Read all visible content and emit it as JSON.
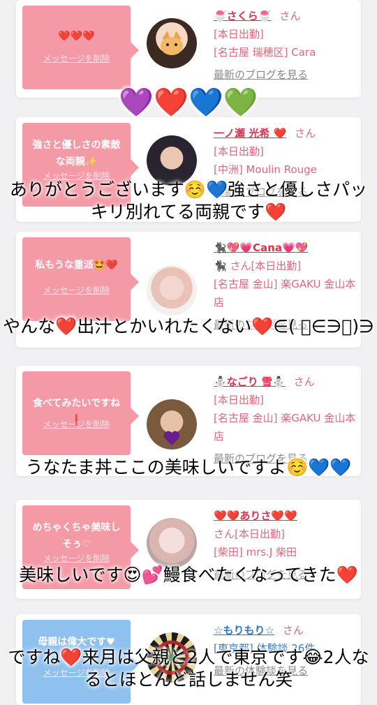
{
  "colors": {
    "pink_bubble": "#f49aa6",
    "blue_bubble": "#8fc1ee",
    "name_red": "#d9334f",
    "name_blue": "#2d78c8",
    "text_pink": "#e0667a"
  },
  "cards": [
    {
      "bubble": "❤️❤️❤️",
      "delete": "メッセージを削除",
      "name": "🍧さくら🍧",
      "san": "さん",
      "details": [
        "[本日出勤]",
        "[名古屋 瑞穂区] Cara"
      ],
      "blog": "最新のブログを見る"
    },
    {
      "bubble": "強さと優しさの素敵な両親✨",
      "delete": "メッセージを削除",
      "name": "一ノ瀬 光希 ❤️",
      "san": "さん",
      "details": [
        "[本日出勤]",
        "[中洲] Moulin Rouge"
      ],
      "blog": "最新のブログを見る"
    },
    {
      "bubble": "私もうな重派🤩❤️",
      "delete": "メッセージを削除",
      "name": "🐈‍⬛💖💗Cana💗💖",
      "san": "🐈‍⬛ さん[本日出勤]",
      "details": [
        "[名古屋 金山] 楽GAKU 金山本店"
      ],
      "blog": "最新のブログを見る"
    },
    {
      "bubble": "食べてみたいですね❗",
      "delete": "メッセージを削除",
      "name": "⛄なごり 雪⛄",
      "san": "さん",
      "details": [
        "[本日出勤]",
        "[名古屋 金山] 楽GAKU 金山本店"
      ],
      "blog": "最新のブログを見る"
    },
    {
      "bubble": "めちゃくちゃ美味しそぅ♡",
      "delete": "メッセージを削除",
      "name": "❤️❤️ありさ❤️❤️",
      "san": "さん[本日出勤]",
      "details": [
        "[柴田] mrs.J 柴田"
      ],
      "blog": "最新のブログを見る"
    },
    {
      "bubble": "母親は偉大です♥",
      "delete": "メッセージを削除",
      "name": "☆もりもり☆",
      "san": "さん",
      "details": [
        "[東京都] 体験談 26件"
      ],
      "blog": "最新の体験談を見る"
    }
  ],
  "overlays": [
    "💜❤️💙💚",
    "ありがとうございます☺️💙強さと優しさパッキリ別れてる両親です❤️",
    "やんな❤️出汁とかいれたくない❤️∈( ﾟ∈∋ﾟ)∋",
    "うなたま丼ここの美味しいですよ☺️💙💙",
    "美味しいです😍💕鰻食べたくなってきた❤️",
    "ですね❤️来月は父親と2人で東京です😂2人なるとほとんど話しません笑"
  ]
}
